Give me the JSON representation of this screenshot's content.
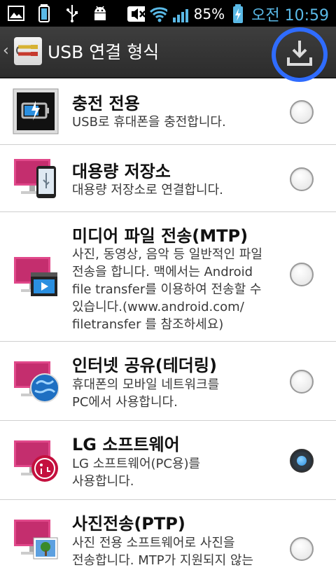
{
  "status_bar": {
    "icons": [
      "gallery-icon",
      "battery-saver-icon",
      "usb-icon",
      "android-debug-icon",
      "mute-icon",
      "wifi-icon",
      "signal-icon",
      "battery-charging-icon"
    ],
    "battery": "85%",
    "time": "오전 10:59"
  },
  "action_bar": {
    "back": "‹",
    "title": "USB 연결 형식",
    "download_icon": "download-icon",
    "annotation_color": "#2f6cff"
  },
  "options": [
    {
      "icon": "charge-icon",
      "title": "충전 전용",
      "desc": [
        "USB로 휴대폰을 충전합니다."
      ],
      "selected": false
    },
    {
      "icon": "mass-storage-icon",
      "title": "대용량 저장소",
      "desc": [
        "대용량 저장소로 연결합니다."
      ],
      "selected": false
    },
    {
      "icon": "media-transfer-icon",
      "title": "미디어 파일 전송(MTP)",
      "desc": [
        "사진, 동영상, 음악 등 일반적인 파일",
        "전송을 합니다. 맥에서는 Android",
        "file transfer를 이용하여 전송할 수",
        "있습니다.(www.android.com/",
        "filetransfer 를 참조하세요)"
      ],
      "selected": false
    },
    {
      "icon": "internet-sharing-icon",
      "title": "인터넷 공유(테더링)",
      "desc": [
        "휴대폰의 모바일 네트워크를",
        "PC에서 사용합니다."
      ],
      "selected": false
    },
    {
      "icon": "lg-software-icon",
      "title": "LG 소프트웨어",
      "desc": [
        "LG 소프트웨어(PC용)를",
        "사용합니다."
      ],
      "selected": true
    },
    {
      "icon": "photo-transfer-icon",
      "title": "사진전송(PTP)",
      "desc": [
        "사진 전용 소프트웨어로 사진을",
        "전송합니다. MTP가 지원되지 않는"
      ],
      "selected": false
    }
  ],
  "colors": {
    "accent": "#5ab9e6",
    "radio_selected": "#2a8fe0"
  }
}
